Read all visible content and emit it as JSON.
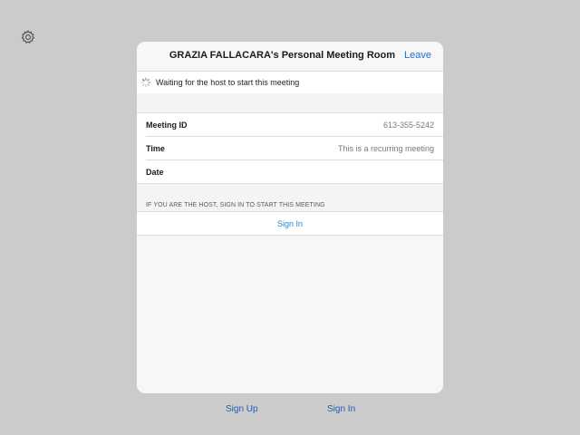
{
  "header": {
    "title": "GRAZIA FALLACARA's Personal Meeting Room",
    "leave_label": "Leave"
  },
  "status": {
    "waiting_text": "Waiting for the host to start this meeting"
  },
  "details": [
    {
      "label": "Meeting ID",
      "value": "613-355-5242"
    },
    {
      "label": "Time",
      "value": "This is a recurring meeting"
    },
    {
      "label": "Date",
      "value": ""
    }
  ],
  "host_section": {
    "caption": "IF YOU ARE THE HOST, SIGN IN TO START THIS MEETING",
    "sign_in_label": "Sign In"
  },
  "footer": {
    "sign_up_label": "Sign Up",
    "sign_in_label": "Sign In"
  },
  "icons": {
    "settings": "gear-icon",
    "loading": "spinner-icon"
  },
  "colors": {
    "background": "#cbcbcb",
    "link": "#1e88d8",
    "header_link": "#1f6bd8"
  }
}
